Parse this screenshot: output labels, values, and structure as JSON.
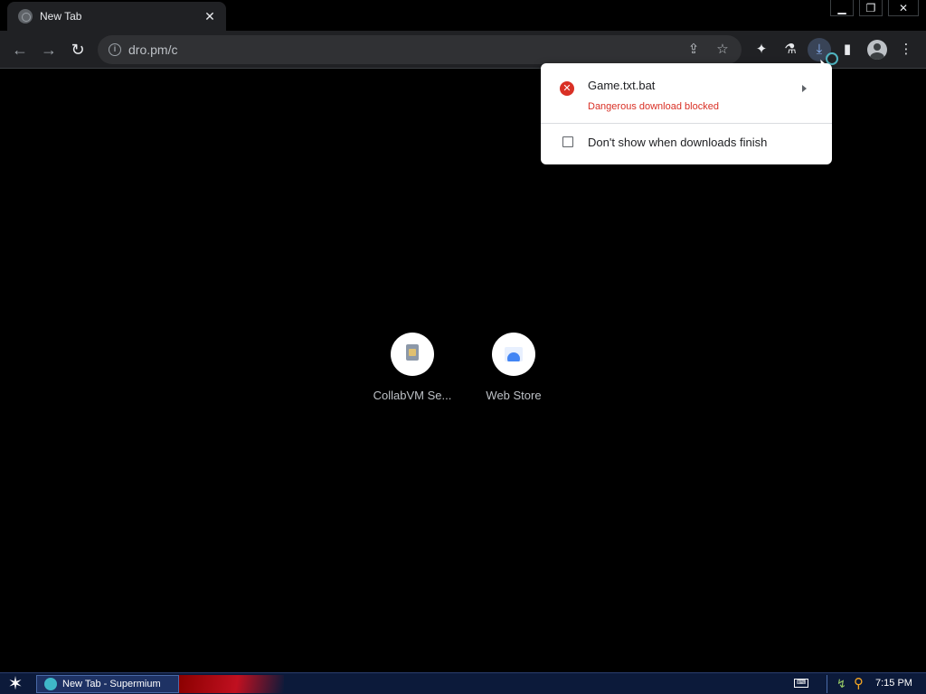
{
  "browser": {
    "tab": {
      "title": "New Tab",
      "close_glyph": "✕"
    },
    "window_controls": {
      "minimize": "▁",
      "restore": "❐",
      "close": "✕"
    },
    "nav": {
      "back": "←",
      "forward": "→",
      "reload": "↻"
    },
    "omnibox": {
      "info_glyph": "i",
      "url": "dro.pm/c",
      "share_glyph": "⇪",
      "star_glyph": "☆"
    },
    "toolbar_icons": {
      "extensions": "✦",
      "labs": "⚗",
      "download": "⤓",
      "side_panel": "▮",
      "menu": "⋮"
    }
  },
  "download_bubble": {
    "file_name": "Game.txt.bat",
    "status": "Dangerous download blocked",
    "error_glyph": "✕",
    "checkbox_label": "Don't show when downloads finish",
    "checkbox_checked": false
  },
  "shortcuts": [
    {
      "label": "CollabVM Se...",
      "icon": "collabvm-icon"
    },
    {
      "label": "Web Store",
      "icon": "web-store-icon"
    }
  ],
  "taskbar": {
    "start_glyph": "✶",
    "task_label": "New Tab - Supermium",
    "keyboard_glyph": "⌨",
    "network_glyph": "↯",
    "search_glyph": "⚲",
    "clock": "7:15 PM"
  },
  "colors": {
    "background": "#000000",
    "chrome": "#202124",
    "accent_blue": "#8ab4f8",
    "danger_red": "#d93025",
    "taskbar": "#0c1a3a"
  }
}
